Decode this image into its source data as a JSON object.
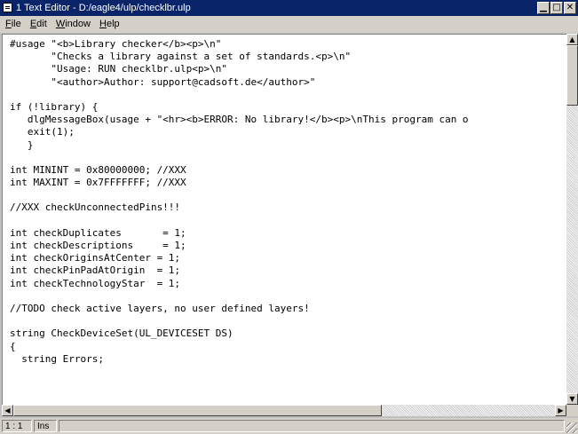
{
  "window": {
    "title": "1 Text Editor - D:/eagle4/ulp/checklbr.ulp",
    "controls": [
      "minimize-icon",
      "maximize-icon",
      "close-icon"
    ]
  },
  "menu": {
    "items": [
      {
        "mnemonic": "F",
        "rest": "ile"
      },
      {
        "mnemonic": "E",
        "rest": "dit"
      },
      {
        "mnemonic": "W",
        "rest": "indow"
      },
      {
        "mnemonic": "H",
        "rest": "elp"
      }
    ]
  },
  "editor": {
    "lines": [
      "#usage \"<b>Library checker</b><p>\\n\"",
      "       \"Checks a library against a set of standards.<p>\\n\"",
      "       \"Usage: RUN checklbr.ulp<p>\\n\"",
      "       \"<author>Author: support@cadsoft.de</author>\"",
      "",
      "if (!library) {",
      "   dlgMessageBox(usage + \"<hr><b>ERROR: No library!</b><p>\\nThis program can o",
      "   exit(1);",
      "   }",
      "",
      "int MININT = 0x80000000; //XXX",
      "int MAXINT = 0x7FFFFFFF; //XXX",
      "",
      "//XXX checkUnconnectedPins!!!",
      "",
      "int checkDuplicates       = 1;",
      "int checkDescriptions     = 1;",
      "int checkOriginsAtCenter = 1;",
      "int checkPinPadAtOrigin  = 1;",
      "int checkTechnologyStar  = 1;",
      "",
      "//TODO check active layers, no user defined layers!",
      "",
      "string CheckDeviceSet(UL_DEVICESET DS)",
      "{",
      "  string Errors;"
    ]
  },
  "status": {
    "position": "1 : 1",
    "mode": "Ins"
  }
}
